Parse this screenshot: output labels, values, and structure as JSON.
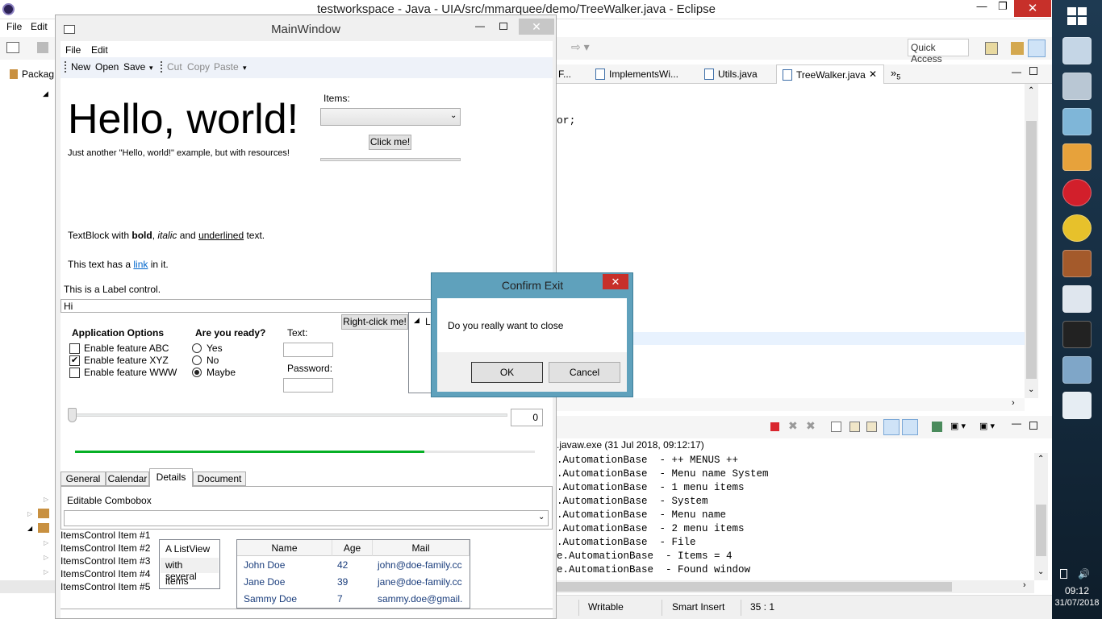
{
  "eclipse": {
    "title": "testworkspace - Java - UIA/src/mmarquee/demo/TreeWalker.java - Eclipse",
    "menu": [
      "File",
      "Edit"
    ],
    "quick_access": "Quick Access",
    "package_tab": "Packag",
    "editor_tabs": [
      "F...",
      "ImplementsWi...",
      "Utils.java",
      "TreeWalker.java"
    ],
    "overflow_tab": "»",
    "overflow_count": "5",
    "code_fragment": "or;",
    "console_header": ".javaw.exe (31 Jul 2018, 09:12:17)",
    "console_lines": [
      ".AutomationBase  - ++ MENUS ++",
      ".AutomationBase  - Menu name System",
      ".AutomationBase  - 1 menu items",
      ".AutomationBase  - System",
      ".AutomationBase  - Menu name",
      ".AutomationBase  - 2 menu items",
      ".AutomationBase  - File",
      "e.AutomationBase  - Items = 4",
      "e.AutomationBase  - Found window"
    ],
    "status": {
      "writable": "Writable",
      "insert": "Smart Insert",
      "position": "35 : 1"
    }
  },
  "taskbar": {
    "time": "09:12",
    "date": "31/07/2018",
    "icons": [
      "desktop-icon",
      "recorder-icon",
      "eraser-icon",
      "media-player-icon",
      "opera-icon",
      "chrome-icon",
      "java-ee-ide-icon",
      "monitor-icon",
      "cmd-icon",
      "remote-desktop-icon",
      "window-app-icon"
    ]
  },
  "main": {
    "title": "MainWindow",
    "menu": [
      "File",
      "Edit"
    ],
    "toolbar1": [
      "New",
      "Open",
      "Save"
    ],
    "toolbar2": [
      "Cut",
      "Copy",
      "Paste"
    ],
    "hello": "Hello, world!",
    "hello_sub": "Just another \"Hello, world!\" example, but with resources!",
    "items_label": "Items:",
    "click_me": "Click me!",
    "tb_pre": "TextBlock with ",
    "tb_bold": "bold",
    "tb_sep": ", ",
    "tb_italic": "italic",
    "tb_and": " and ",
    "tb_under": "underlined",
    "tb_end": " text.",
    "link_pre": "This text has a ",
    "link": "link",
    "link_post": " in it.",
    "label_ctrl": "This is a Label control.",
    "textbox": "Hi",
    "app_options": "Application Options",
    "features": [
      {
        "label": "Enable feature ABC",
        "checked": false
      },
      {
        "label": "Enable feature XYZ",
        "checked": true
      },
      {
        "label": "Enable feature WWW",
        "checked": false
      }
    ],
    "ready": "Are you ready?",
    "ready_opts": [
      {
        "label": "Yes",
        "selected": false
      },
      {
        "label": "No",
        "selected": false
      },
      {
        "label": "Maybe",
        "selected": true
      }
    ],
    "text_label": "Text:",
    "password_label": "Password:",
    "right_click": "Right-click me!",
    "tree_item": "L",
    "slider_value": "0",
    "progress": 0.76,
    "tabs": [
      "General",
      "Calendar",
      "Details",
      "Document"
    ],
    "editable_combo": "Editable Combobox",
    "items_control": [
      "ItemsControl Item #1",
      "ItemsControl Item #2",
      "ItemsControl Item #3",
      "ItemsControl Item #4",
      "ItemsControl Item #5"
    ],
    "listview": [
      "A ListView",
      "with several",
      "items"
    ],
    "grid_headers": [
      "Name",
      "Age",
      "Mail"
    ],
    "grid_rows": [
      [
        "John Doe",
        "42",
        "john@doe-family.cc"
      ],
      [
        "Jane Doe",
        "39",
        "jane@doe-family.cc"
      ],
      [
        "Sammy Doe",
        "7",
        "sammy.doe@gmail."
      ]
    ]
  },
  "dialog": {
    "title": "Confirm Exit",
    "message": "Do you really want to close",
    "ok": "OK",
    "cancel": "Cancel"
  },
  "colors": {
    "dialog_frame": "#5fa1bc",
    "link": "#0066cc",
    "progress": "#06b025",
    "close_red": "#c7302a"
  }
}
